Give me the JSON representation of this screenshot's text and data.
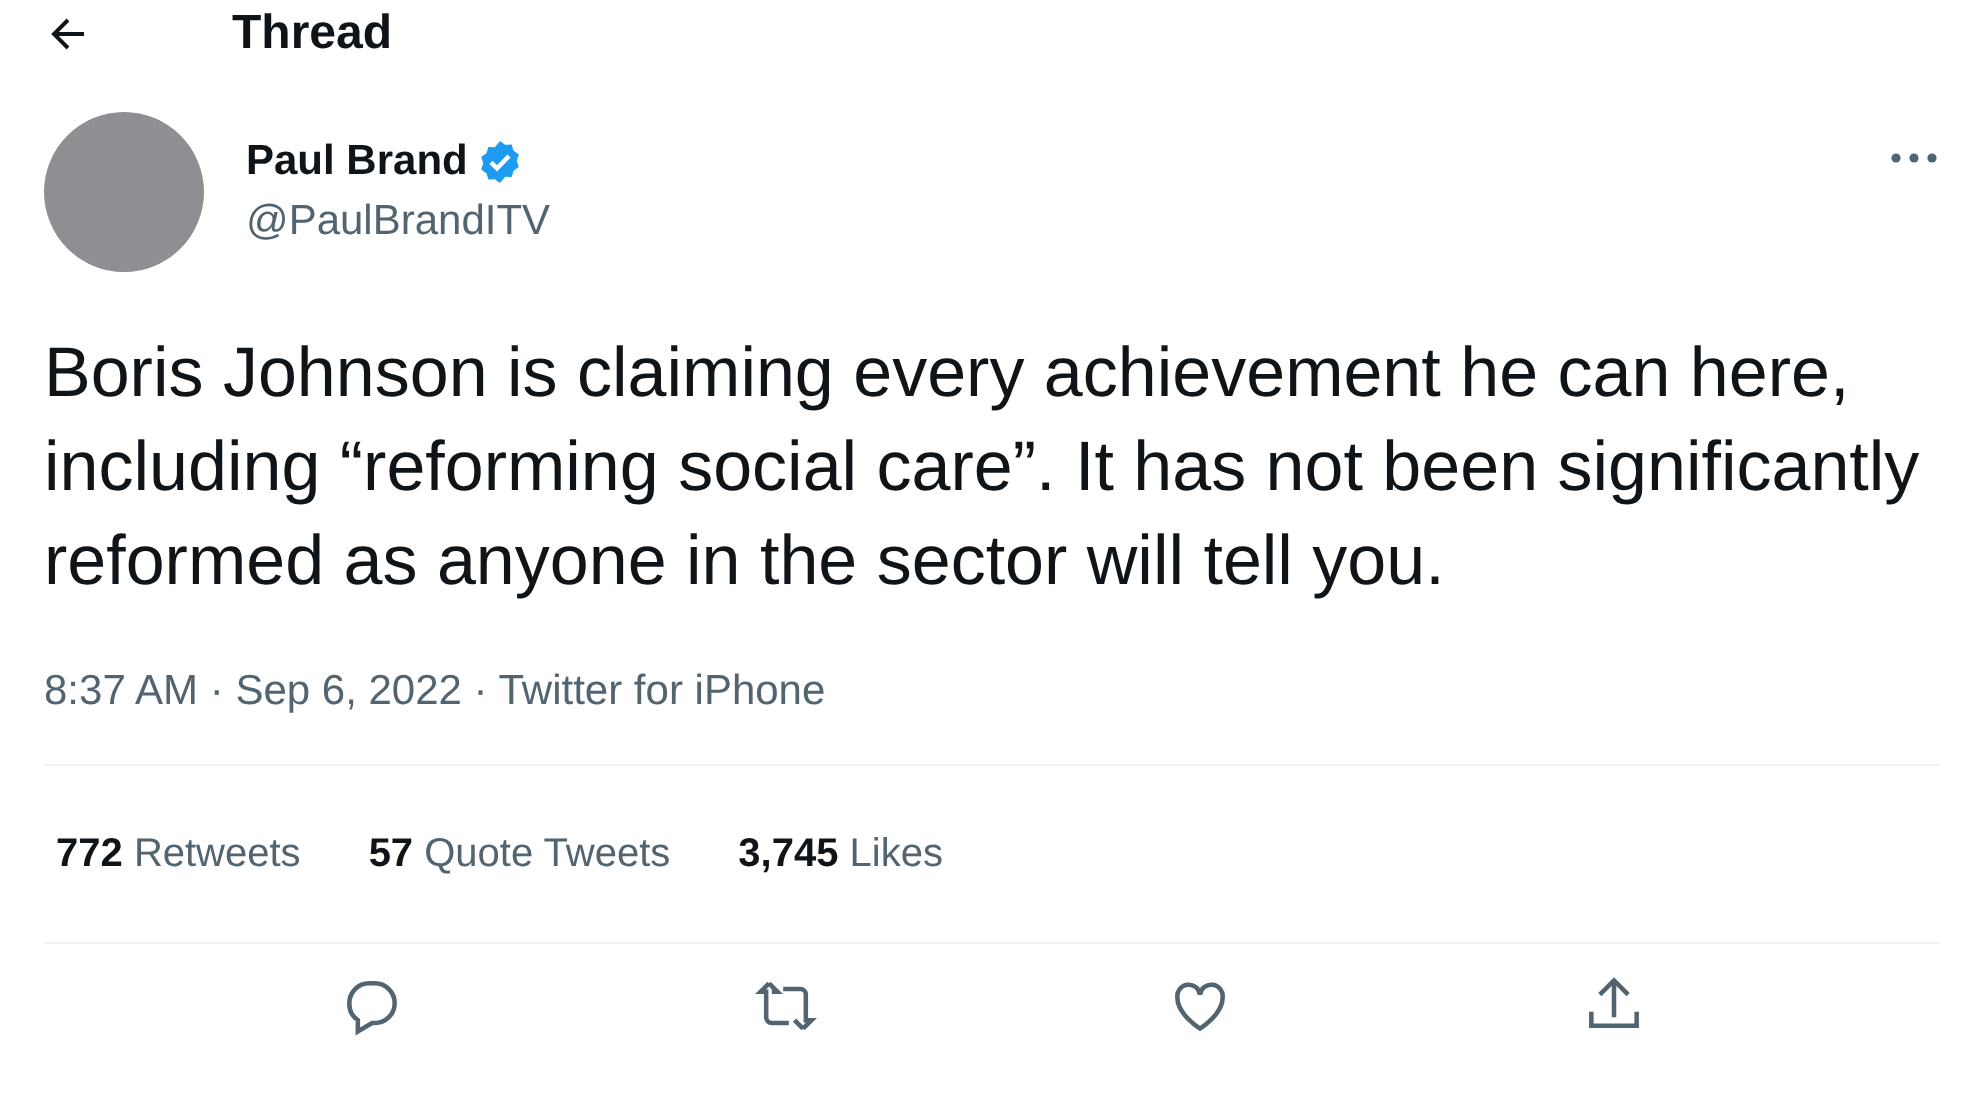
{
  "header": {
    "title": "Thread"
  },
  "tweet": {
    "author": {
      "name": "Paul Brand",
      "verified": true,
      "handle": "@PaulBrandITV"
    },
    "text": "Boris Johnson is claiming every achievement he can here, including “reforming social care”. It has not been significantly reformed as anyone in the sector will tell you.",
    "meta": "8:37 AM · Sep 6, 2022 · Twitter for iPhone",
    "stats": [
      {
        "count": "772",
        "label": "Retweets"
      },
      {
        "count": "57",
        "label": "Quote Tweets"
      },
      {
        "count": "3,745",
        "label": "Likes"
      }
    ]
  }
}
